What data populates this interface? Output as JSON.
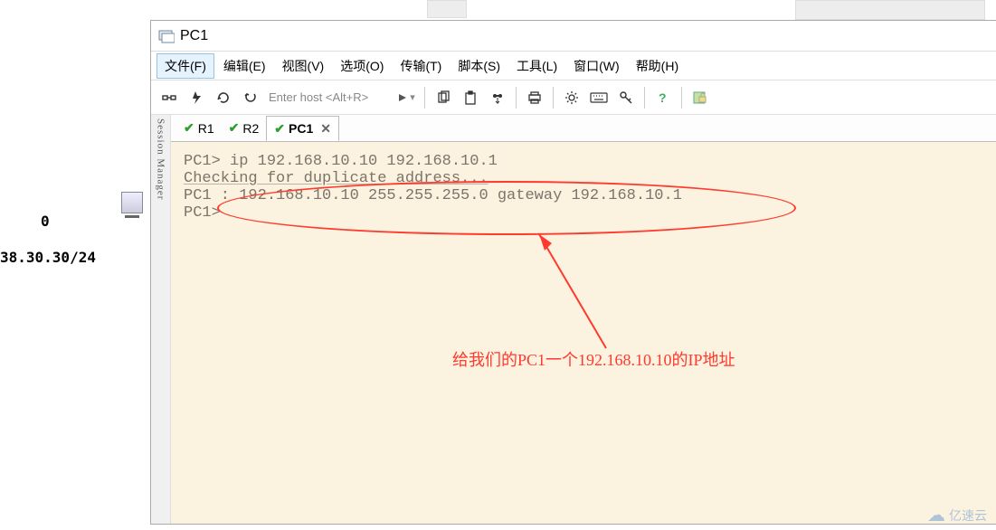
{
  "bg": {
    "label0": "0",
    "labelIp": "38.30.30/24"
  },
  "window": {
    "title": "PC1",
    "menu": [
      "文件(F)",
      "编辑(E)",
      "视图(V)",
      "选项(O)",
      "传输(T)",
      "脚本(S)",
      "工具(L)",
      "窗口(W)",
      "帮助(H)"
    ],
    "hostPlaceholder": "Enter host <Alt+R>",
    "sideTab": "Session Manager"
  },
  "tabs": [
    {
      "key": "r1",
      "label": "R1"
    },
    {
      "key": "r2",
      "label": "R2"
    },
    {
      "key": "pc1",
      "label": "PC1",
      "active": true,
      "closable": true
    }
  ],
  "terminal": {
    "lines": [
      "PC1> ip 192.168.10.10 192.168.10.1",
      "Checking for duplicate address...",
      "PC1 : 192.168.10.10 255.255.255.0 gateway 192.168.10.1",
      "",
      "PC1>"
    ]
  },
  "annotation": "给我们的PC1一个192.168.10.10的IP地址",
  "watermark": "亿速云"
}
